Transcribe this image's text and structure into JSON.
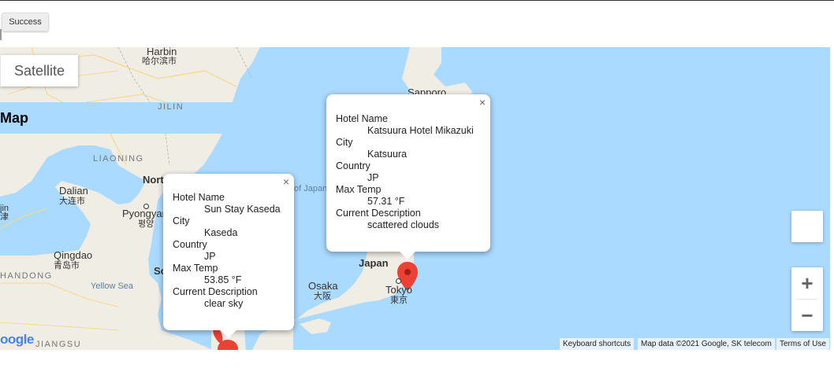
{
  "top": {
    "success_label": "Success"
  },
  "map_type": {
    "map": "Map",
    "satellite": "Satellite"
  },
  "labels": {
    "harbin": "Harbin",
    "harbin_zh": "哈尔滨市",
    "jilin": "JILIN",
    "liaoning": "LIAONING",
    "dalian": "Dalian",
    "dalian_zh": "大连市",
    "pyongyang": "Pyongyang",
    "pyongyang_ko": "평양",
    "north": "Nort",
    "qingdao": "Qingdao",
    "qingdao_zh": "青岛市",
    "shandong": "HANDONG",
    "jin": "jin",
    "jin_zh": "津",
    "yellow_sea": "Yellow Sea",
    "south": "So",
    "sea_of_japan": "of Japan",
    "sapporo": "Sapporo",
    "japan": "Japan",
    "osaka": "Osaka",
    "osaka_ja": "大阪",
    "tokyo": "Tokyo",
    "tokyo_ja": "東京",
    "jiangsu": "JIANGSU"
  },
  "infowindows": [
    {
      "close": "×",
      "rows": [
        {
          "k": "Hotel Name",
          "v": "Sun Stay Kaseda"
        },
        {
          "k": "City",
          "v": "Kaseda"
        },
        {
          "k": "Country",
          "v": "JP"
        },
        {
          "k": "Max Temp",
          "v": "53.85 °F"
        },
        {
          "k": "Current Description",
          "v": "clear sky"
        }
      ]
    },
    {
      "close": "×",
      "rows": [
        {
          "k": "Hotel Name",
          "v": "Katsuura Hotel Mikazuki"
        },
        {
          "k": "City",
          "v": "Katsuura"
        },
        {
          "k": "Country",
          "v": "JP"
        },
        {
          "k": "Max Temp",
          "v": "57.31 °F"
        },
        {
          "k": "Current Description",
          "v": "scattered clouds"
        }
      ]
    }
  ],
  "zoom": {
    "in": "+",
    "out": "−"
  },
  "attribution": {
    "shortcuts": "Keyboard shortcuts",
    "mapdata": "Map data ©2021 Google, SK telecom",
    "terms": "Terms of Use"
  },
  "logo": {
    "text": "oogle"
  },
  "colors": {
    "water": "#aadaff",
    "land": "#f0ede5",
    "marker": "#ea4335"
  }
}
